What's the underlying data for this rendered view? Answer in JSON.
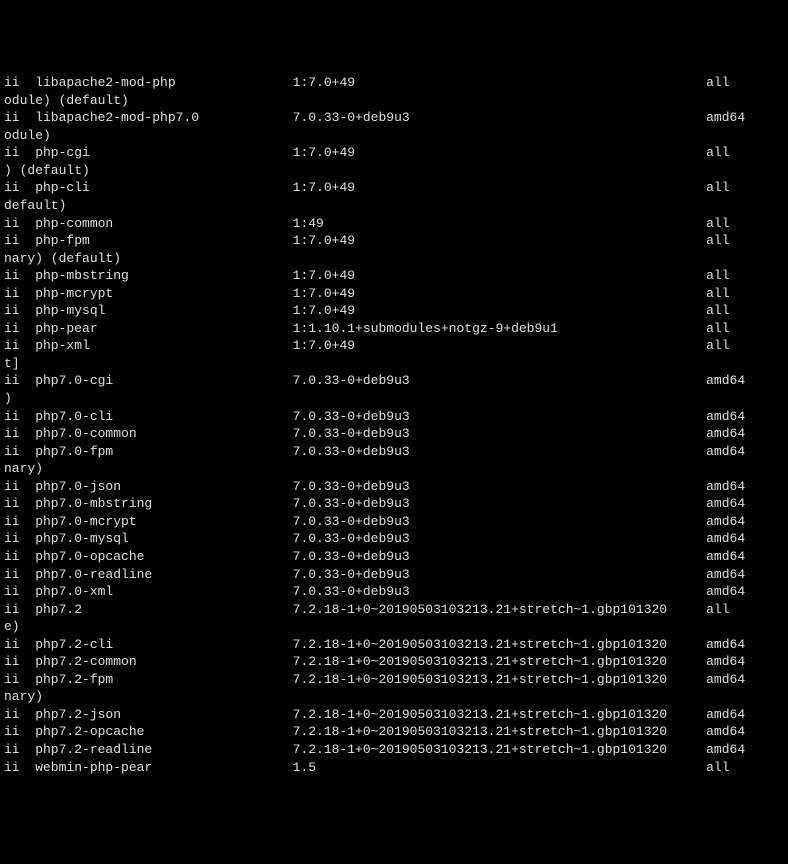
{
  "rows": [
    {
      "status": "ii",
      "name": "libapache2-mod-php",
      "version": "1:7.0+49",
      "arch": "all"
    },
    {
      "wrap": "odule) (default)"
    },
    {
      "status": "ii",
      "name": "libapache2-mod-php7.0",
      "version": "7.0.33-0+deb9u3",
      "arch": "amd64"
    },
    {
      "wrap": "odule)"
    },
    {
      "status": "ii",
      "name": "php-cgi",
      "version": "1:7.0+49",
      "arch": "all"
    },
    {
      "wrap": ") (default)"
    },
    {
      "status": "ii",
      "name": "php-cli",
      "version": "1:7.0+49",
      "arch": "all"
    },
    {
      "wrap": "default)"
    },
    {
      "status": "ii",
      "name": "php-common",
      "version": "1:49",
      "arch": "all"
    },
    {
      "status": "ii",
      "name": "php-fpm",
      "version": "1:7.0+49",
      "arch": "all"
    },
    {
      "wrap": "nary) (default)"
    },
    {
      "status": "ii",
      "name": "php-mbstring",
      "version": "1:7.0+49",
      "arch": "all"
    },
    {
      "status": "ii",
      "name": "php-mcrypt",
      "version": "1:7.0+49",
      "arch": "all"
    },
    {
      "status": "ii",
      "name": "php-mysql",
      "version": "1:7.0+49",
      "arch": "all"
    },
    {
      "status": "ii",
      "name": "php-pear",
      "version": "1:1.10.1+submodules+notgz-9+deb9u1",
      "arch": "all"
    },
    {
      "status": "ii",
      "name": "php-xml",
      "version": "1:7.0+49",
      "arch": "all"
    },
    {
      "wrap": "t]"
    },
    {
      "status": "ii",
      "name": "php7.0-cgi",
      "version": "7.0.33-0+deb9u3",
      "arch": "amd64"
    },
    {
      "wrap": ")"
    },
    {
      "status": "ii",
      "name": "php7.0-cli",
      "version": "7.0.33-0+deb9u3",
      "arch": "amd64"
    },
    {
      "status": "ii",
      "name": "php7.0-common",
      "version": "7.0.33-0+deb9u3",
      "arch": "amd64"
    },
    {
      "status": "ii",
      "name": "php7.0-fpm",
      "version": "7.0.33-0+deb9u3",
      "arch": "amd64"
    },
    {
      "wrap": "nary)"
    },
    {
      "status": "ii",
      "name": "php7.0-json",
      "version": "7.0.33-0+deb9u3",
      "arch": "amd64"
    },
    {
      "status": "ii",
      "name": "php7.0-mbstring",
      "version": "7.0.33-0+deb9u3",
      "arch": "amd64"
    },
    {
      "status": "ii",
      "name": "php7.0-mcrypt",
      "version": "7.0.33-0+deb9u3",
      "arch": "amd64"
    },
    {
      "status": "ii",
      "name": "php7.0-mysql",
      "version": "7.0.33-0+deb9u3",
      "arch": "amd64"
    },
    {
      "status": "ii",
      "name": "php7.0-opcache",
      "version": "7.0.33-0+deb9u3",
      "arch": "amd64"
    },
    {
      "status": "ii",
      "name": "php7.0-readline",
      "version": "7.0.33-0+deb9u3",
      "arch": "amd64"
    },
    {
      "status": "ii",
      "name": "php7.0-xml",
      "version": "7.0.33-0+deb9u3",
      "arch": "amd64"
    },
    {
      "status": "ii",
      "name": "php7.2",
      "version": "7.2.18-1+0~20190503103213.21+stretch~1.gbp101320",
      "arch": "all"
    },
    {
      "wrap": "e)"
    },
    {
      "status": "ii",
      "name": "php7.2-cli",
      "version": "7.2.18-1+0~20190503103213.21+stretch~1.gbp101320",
      "arch": "amd64"
    },
    {
      "status": "ii",
      "name": "php7.2-common",
      "version": "7.2.18-1+0~20190503103213.21+stretch~1.gbp101320",
      "arch": "amd64"
    },
    {
      "status": "ii",
      "name": "php7.2-fpm",
      "version": "7.2.18-1+0~20190503103213.21+stretch~1.gbp101320",
      "arch": "amd64"
    },
    {
      "wrap": "nary)"
    },
    {
      "status": "ii",
      "name": "php7.2-json",
      "version": "7.2.18-1+0~20190503103213.21+stretch~1.gbp101320",
      "arch": "amd64"
    },
    {
      "status": "ii",
      "name": "php7.2-opcache",
      "version": "7.2.18-1+0~20190503103213.21+stretch~1.gbp101320",
      "arch": "amd64"
    },
    {
      "status": "ii",
      "name": "php7.2-readline",
      "version": "7.2.18-1+0~20190503103213.21+stretch~1.gbp101320",
      "arch": "amd64"
    },
    {
      "status": "ii",
      "name": "webmin-php-pear",
      "version": "1.5",
      "arch": "all"
    }
  ],
  "columns": {
    "status_width": 4,
    "name_width": 33,
    "version_width": 53,
    "arch_width": 6
  }
}
